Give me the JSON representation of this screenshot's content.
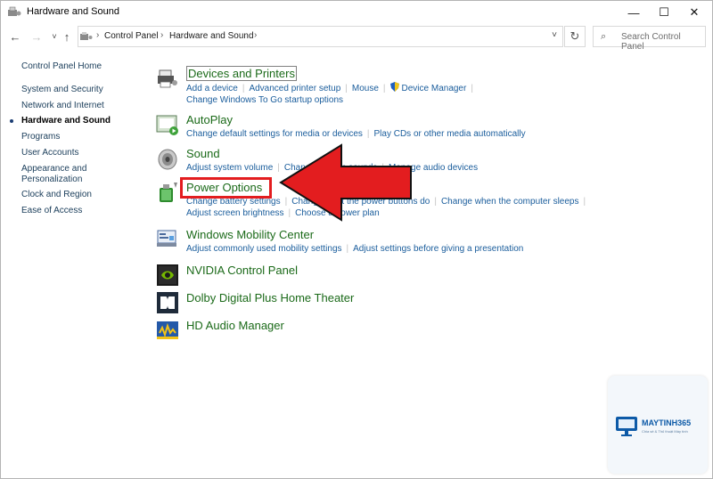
{
  "window": {
    "title": "Hardware and Sound"
  },
  "titlebar": {
    "minimize": "—",
    "maximize": "☐",
    "close": "✕"
  },
  "nav": {
    "back": "←",
    "forward": "→",
    "recent": "˅",
    "up": "↑",
    "refresh": "↻",
    "dropdown": "˅"
  },
  "breadcrumb": [
    "Control Panel",
    "Hardware and Sound"
  ],
  "search": {
    "placeholder": "Search Control Panel"
  },
  "sidebar": {
    "items": [
      {
        "label": "Control Panel Home"
      },
      {
        "label": "System and Security"
      },
      {
        "label": "Network and Internet"
      },
      {
        "label": "Hardware and Sound",
        "active": true
      },
      {
        "label": "Programs"
      },
      {
        "label": "User Accounts"
      },
      {
        "label": "Appearance and Personalization"
      },
      {
        "label": "Clock and Region"
      },
      {
        "label": "Ease of Access"
      }
    ]
  },
  "categories": [
    {
      "title": "Devices and Printers",
      "icon": "printer-icon",
      "links_row1": [
        "Add a device",
        "Advanced printer setup",
        "Mouse",
        "Device Manager"
      ],
      "links_row2": [
        "Change Windows To Go startup options"
      ]
    },
    {
      "title": "AutoPlay",
      "icon": "autoplay-icon",
      "links_row1": [
        "Change default settings for media or devices",
        "Play CDs or other media automatically"
      ]
    },
    {
      "title": "Sound",
      "icon": "speaker-icon",
      "links_row1": [
        "Adjust system volume",
        "Change system sounds",
        "Manage audio devices"
      ]
    },
    {
      "title": "Power Options",
      "icon": "power-icon",
      "links_row1": [
        "Change battery settings",
        "Change what the power buttons do",
        "Change when the computer sleeps"
      ],
      "links_row2": [
        "Adjust screen brightness",
        "Choose a power plan"
      ]
    },
    {
      "title": "Windows Mobility Center",
      "icon": "mobility-icon",
      "links_row1": [
        "Adjust commonly used mobility settings",
        "Adjust settings before giving a presentation"
      ]
    },
    {
      "title": "NVIDIA Control Panel",
      "icon": "nvidia-icon"
    },
    {
      "title": "Dolby Digital Plus Home Theater",
      "icon": "dolby-icon"
    },
    {
      "title": "HD Audio Manager",
      "icon": "hd-audio-icon"
    }
  ],
  "watermark": {
    "brand": "MAYTINH365",
    "tagline": "Chia sẻ & Thủ thuật Máy tính"
  },
  "colors": {
    "link": "#1a5d9c",
    "title": "#1b6a19",
    "highlight": "#e31d1f"
  }
}
